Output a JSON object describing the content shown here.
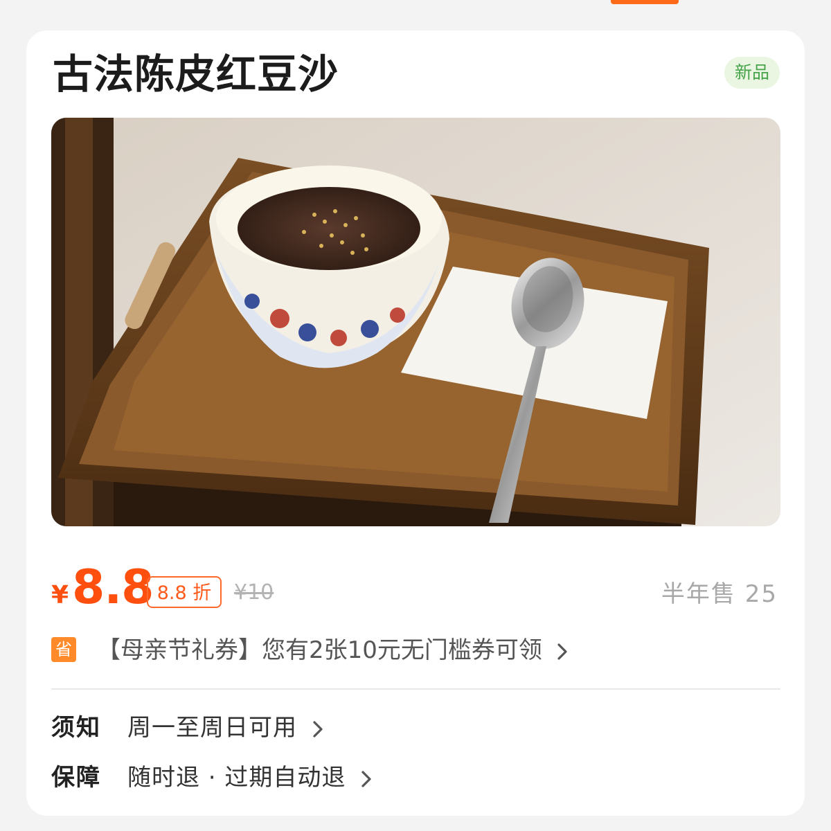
{
  "product": {
    "title": "古法陈皮红豆沙",
    "badge": "新品"
  },
  "price": {
    "currency": "¥",
    "current": "8.8",
    "discount": "8.8 折",
    "original": "¥10",
    "sales": "半年售 25"
  },
  "coupon": {
    "icon_label": "省",
    "text": "【母亲节礼券】您有2张10元无门槛券可领"
  },
  "info": [
    {
      "label": "须知",
      "value": "周一至周日可用"
    },
    {
      "label": "保障",
      "value": "随时退 · 过期自动退"
    }
  ],
  "colors": {
    "accent": "#ff4f0f",
    "badge_green": "#46a34a",
    "badge_bg": "#eaf6e2"
  },
  "icons": {
    "chevron": "chevron-right-icon",
    "save": "save-icon"
  }
}
